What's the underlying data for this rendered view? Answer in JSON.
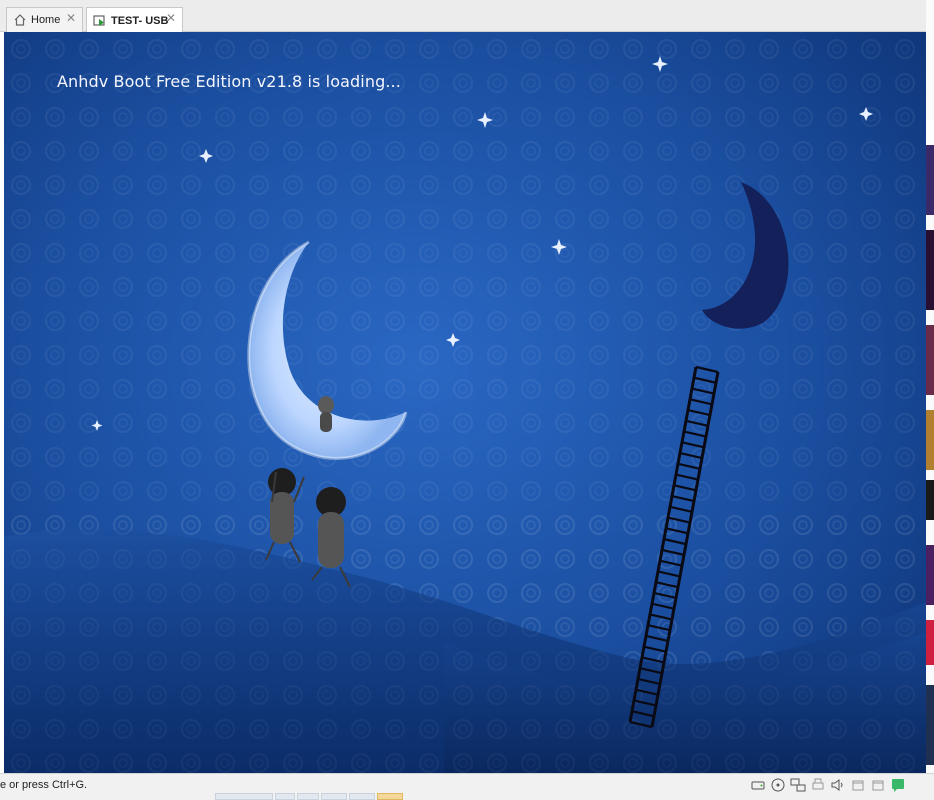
{
  "tabs": [
    {
      "label": "Home",
      "icon": "home-icon",
      "active": false
    },
    {
      "label": "TEST- USB",
      "icon": "vm-running-icon",
      "active": true
    }
  ],
  "vm_screen": {
    "boot_message": "Anhdv Boot Free Edition v21.8 is loading...",
    "background": "night sky with crescent moons, ladder and hills",
    "colors": {
      "sky": "#1a4d9e",
      "hill": "#0f3a80",
      "moon": "#cde3ff",
      "dark_moon": "#13205a"
    }
  },
  "status_bar": {
    "hint_text": "e or press Ctrl+G.",
    "device_icons": [
      "hard-disk-icon",
      "cd-dvd-icon",
      "network-icon",
      "printer-icon",
      "sound-icon",
      "usb-icon",
      "usb-icon-2",
      "message-icon"
    ]
  }
}
